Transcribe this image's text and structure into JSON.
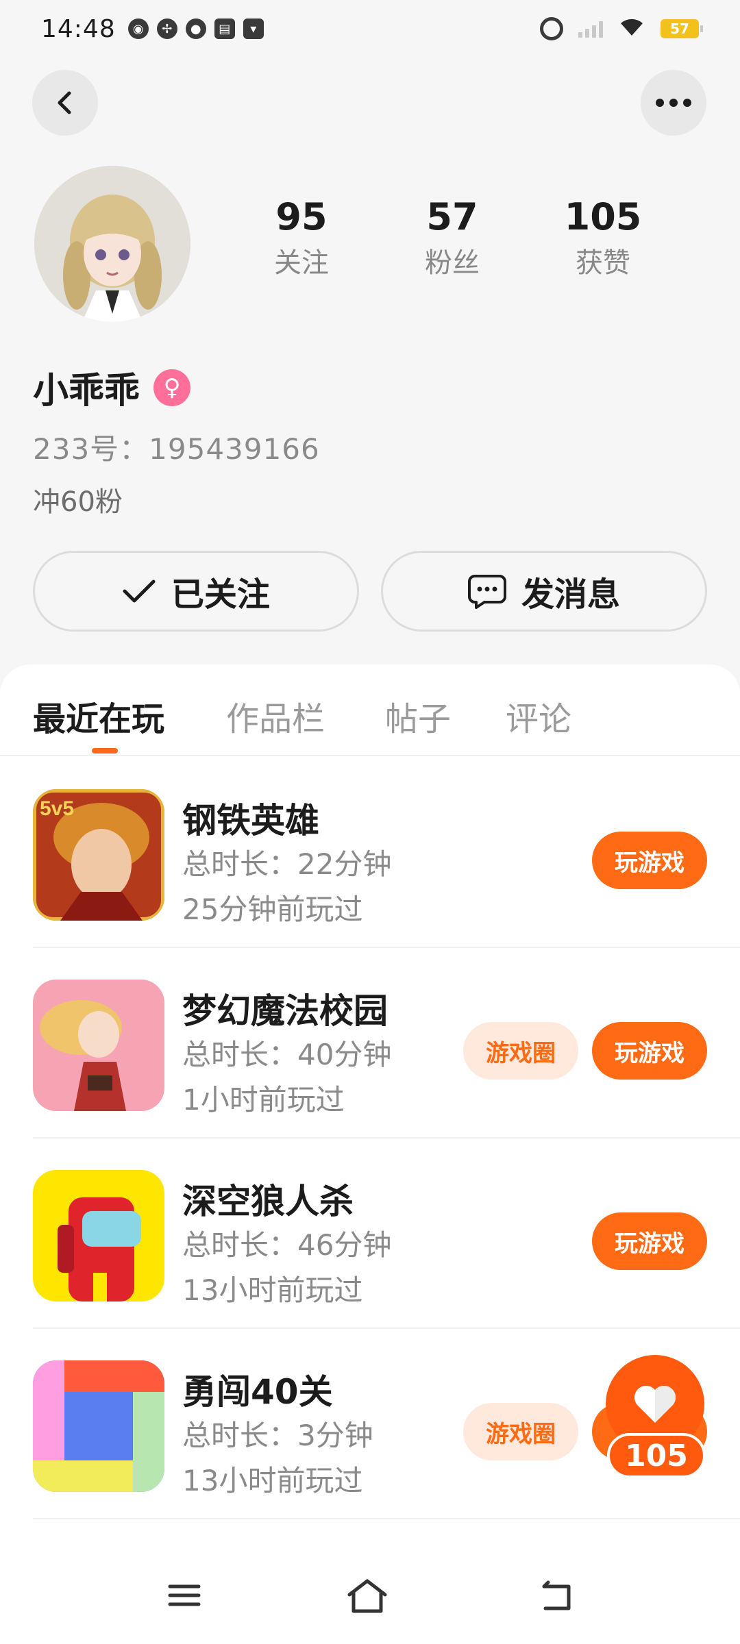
{
  "status_bar": {
    "time": "14:48",
    "battery": "57"
  },
  "profile": {
    "stats": [
      {
        "value": "95",
        "label": "关注"
      },
      {
        "value": "57",
        "label": "粉丝"
      },
      {
        "value": "105",
        "label": "获赞"
      }
    ],
    "username": "小乖乖",
    "gender_symbol": "♀",
    "account_id": "233号：195439166",
    "bio": "冲60粉",
    "follow_button": "已关注",
    "message_button": "发消息"
  },
  "tabs": [
    "最近在玩",
    "作品栏",
    "帖子",
    "评论"
  ],
  "games": [
    {
      "title": "钢铁英雄",
      "duration": "总时长：22分钟",
      "last_played": "25分钟前玩过",
      "play_label": "玩游戏",
      "circle_label": ""
    },
    {
      "title": "梦幻魔法校园",
      "duration": "总时长：40分钟",
      "last_played": "1小时前玩过",
      "play_label": "玩游戏",
      "circle_label": "游戏圈"
    },
    {
      "title": "深空狼人杀",
      "duration": "总时长：46分钟",
      "last_played": "13小时前玩过",
      "play_label": "玩游戏",
      "circle_label": ""
    },
    {
      "title": "勇闯40关",
      "duration": "总时长：3分钟",
      "last_played": "13小时前玩过",
      "play_label": "玩游戏",
      "circle_label": "游戏圈"
    }
  ],
  "like_float": {
    "count": "105"
  },
  "icons": {
    "back": "chevron-left-icon",
    "more": "more-dots-icon",
    "follow": "check-icon",
    "message": "chat-bubble-icon",
    "like": "heart-icon",
    "nav_menu": "menu-icon",
    "nav_home": "home-icon",
    "nav_back": "back-icon"
  },
  "colors": {
    "accent": "#ff6a14",
    "accent_light": "#ffe8dc",
    "gender": "#ff6f9a"
  }
}
